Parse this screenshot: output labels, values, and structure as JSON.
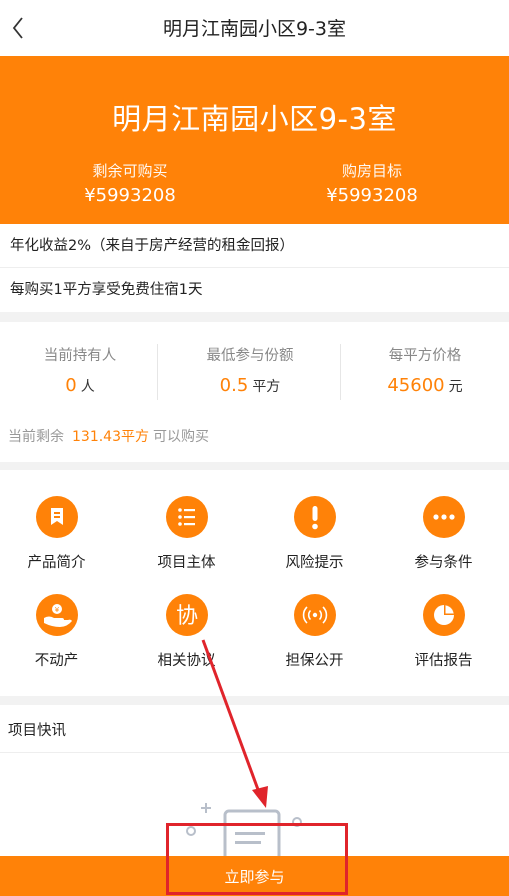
{
  "nav": {
    "title": "明月江南园小区9-3室",
    "back_icon": "chevron-left-icon"
  },
  "hero": {
    "name": "明月江南园小区9-3室",
    "remaining_label": "剩余可购买",
    "remaining_value": "¥5993208",
    "target_label": "购房目标",
    "target_value": "¥5993208"
  },
  "info": {
    "yield": "年化收益2%（来自于房产经营的租金回报）",
    "benefit": "每购买1平方享受免费住宿1天"
  },
  "stats": [
    {
      "label": "当前持有人",
      "value": "0",
      "unit": "人"
    },
    {
      "label": "最低参与份额",
      "value": "0.5",
      "unit": "平方"
    },
    {
      "label": "每平方价格",
      "value": "45600",
      "unit": "元"
    }
  ],
  "remain": {
    "prefix": "当前剩余",
    "value": "131.43平方",
    "suffix": "可以购买"
  },
  "menu": [
    {
      "label": "产品简介",
      "icon": "bookmark-icon"
    },
    {
      "label": "项目主体",
      "icon": "list-icon"
    },
    {
      "label": "风险提示",
      "icon": "exclamation-icon"
    },
    {
      "label": "参与条件",
      "icon": "more-dots-icon"
    },
    {
      "label": "不动产",
      "icon": "hand-coin-icon"
    },
    {
      "label": "相关协议",
      "icon": "agreement-icon",
      "glyph": "协"
    },
    {
      "label": "担保公开",
      "icon": "broadcast-icon"
    },
    {
      "label": "评估报告",
      "icon": "pie-chart-icon"
    }
  ],
  "news": {
    "label": "项目快讯"
  },
  "cta": {
    "label": "立即参与"
  },
  "colors": {
    "accent": "#ff8208",
    "annotation": "#e0242b"
  }
}
